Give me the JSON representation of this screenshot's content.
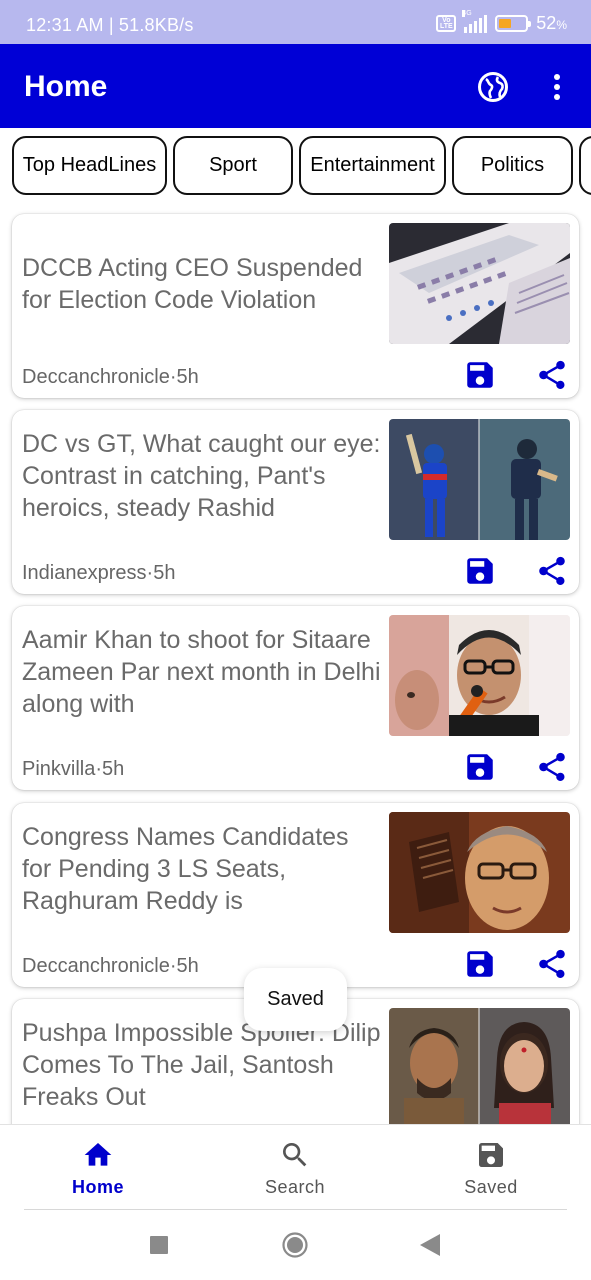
{
  "status_bar": {
    "time": "12:31 AM | 51.8KB/s",
    "volte": "Vo LTE",
    "network": "4G",
    "battery_percent": "52",
    "battery_unit": "%"
  },
  "app_bar": {
    "title": "Home",
    "globe_icon": "globe-icon",
    "more_icon": "more-vert-icon"
  },
  "categories": [
    "Top HeadLines",
    "Sport",
    "Entertainment",
    "Politics"
  ],
  "articles": [
    {
      "headline": "DCCB Acting CEO Suspended for Election Code Violation",
      "source": "Deccanchronicle",
      "age": "5h",
      "thumbnail": "voting machines"
    },
    {
      "headline": "DC vs GT, What caught our eye: Contrast in catching, Pant's heroics, steady Rashid",
      "source": "Indianexpress",
      "age": "5h",
      "thumbnail": "cricket players"
    },
    {
      "headline": "Aamir Khan to shoot for Sitaare Zameen Par next month in Delhi along with",
      "source": "Pinkvilla",
      "age": "5h",
      "thumbnail": "actor at microphone"
    },
    {
      "headline": "Congress Names Candidates for Pending 3 LS Seats, Raghuram Reddy is",
      "source": "Deccanchronicle",
      "age": "5h",
      "thumbnail": "politician portrait"
    },
    {
      "headline": "Pushpa Impossible Spoiler: Dilip Comes To The Jail, Santosh Freaks Out",
      "source": "",
      "age": "",
      "thumbnail": "tv show stills"
    }
  ],
  "separator": "·",
  "toast": "Saved",
  "bottom_nav": [
    {
      "label": "Home",
      "icon": "home-icon",
      "active": true
    },
    {
      "label": "Search",
      "icon": "search-icon",
      "active": false
    },
    {
      "label": "Saved",
      "icon": "save-icon",
      "active": false
    }
  ],
  "colors": {
    "primary": "#0000d6",
    "accent": "#0000cc",
    "status_bar": "#b7b8ee",
    "battery": "#f5a623"
  }
}
